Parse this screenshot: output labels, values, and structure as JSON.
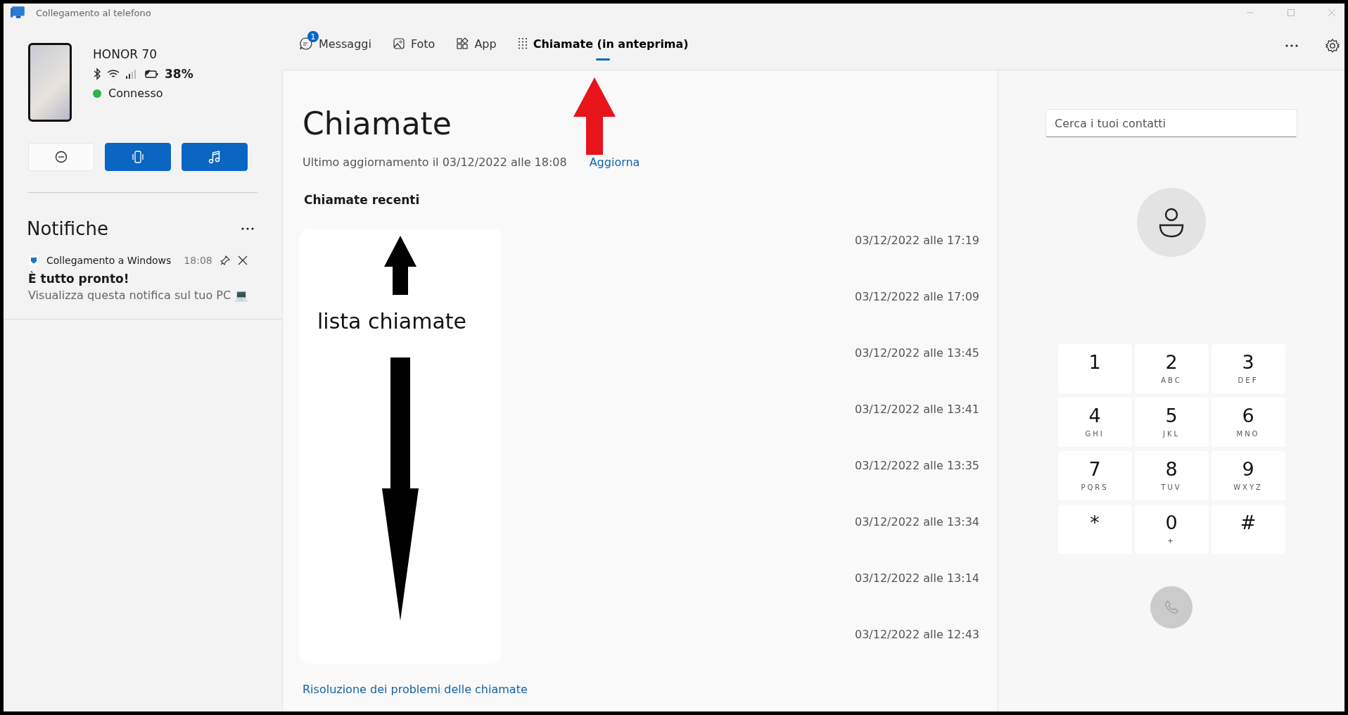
{
  "window": {
    "title": "Collegamento al telefono"
  },
  "device": {
    "name": "HONOR 70",
    "battery": "38%",
    "status": "Connesso",
    "connected": true
  },
  "quick_actions": [
    {
      "kind": "do-not-disturb",
      "on": false
    },
    {
      "kind": "vibrate",
      "on": true
    },
    {
      "kind": "audio",
      "on": true
    }
  ],
  "notifications": {
    "title": "Notifiche",
    "items": [
      {
        "app": "Collegamento a Windows",
        "time": "18:08",
        "title": "È tutto pronto!",
        "body": "Visualizza questa notifica sul tuo PC 💻"
      }
    ]
  },
  "tabs": [
    {
      "kind": "messages",
      "label": "Messaggi",
      "badge": "1",
      "selected": false
    },
    {
      "kind": "photos",
      "label": "Foto",
      "selected": false
    },
    {
      "kind": "apps",
      "label": "App",
      "selected": false
    },
    {
      "kind": "calls",
      "label": "Chiamate (in anteprima)",
      "selected": true
    }
  ],
  "calls": {
    "title": "Chiamate",
    "updated": "Ultimo aggiornamento il 03/12/2022 alle 18:08",
    "refresh": "Aggiorna",
    "recent_title": "Chiamate recenti",
    "rows": [
      {
        "time": "03/12/2022 alle 17:19"
      },
      {
        "time": "03/12/2022 alle 17:09"
      },
      {
        "time": "03/12/2022 alle 13:45"
      },
      {
        "time": "03/12/2022 alle 13:41"
      },
      {
        "time": "03/12/2022 alle 13:35"
      },
      {
        "time": "03/12/2022 alle 13:34"
      },
      {
        "time": "03/12/2022 alle 13:14"
      },
      {
        "time": "03/12/2022 alle 12:43"
      }
    ],
    "troubleshoot": "Risoluzione dei problemi delle chiamate"
  },
  "annotation": {
    "label": "lista chiamate"
  },
  "dialer": {
    "search_placeholder": "Cerca i tuoi contatti",
    "keys": [
      {
        "digit": "1"
      },
      {
        "digit": "2",
        "letters": "ABC"
      },
      {
        "digit": "3",
        "letters": "DEF"
      },
      {
        "digit": "4",
        "letters": "GHI"
      },
      {
        "digit": "5",
        "letters": "JKL"
      },
      {
        "digit": "6",
        "letters": "MNO"
      },
      {
        "digit": "7",
        "letters": "PQRS"
      },
      {
        "digit": "8",
        "letters": "TUV"
      },
      {
        "digit": "9",
        "letters": "WXYZ"
      },
      {
        "digit": "*"
      },
      {
        "digit": "0",
        "letters": "+"
      },
      {
        "digit": "#"
      }
    ]
  }
}
